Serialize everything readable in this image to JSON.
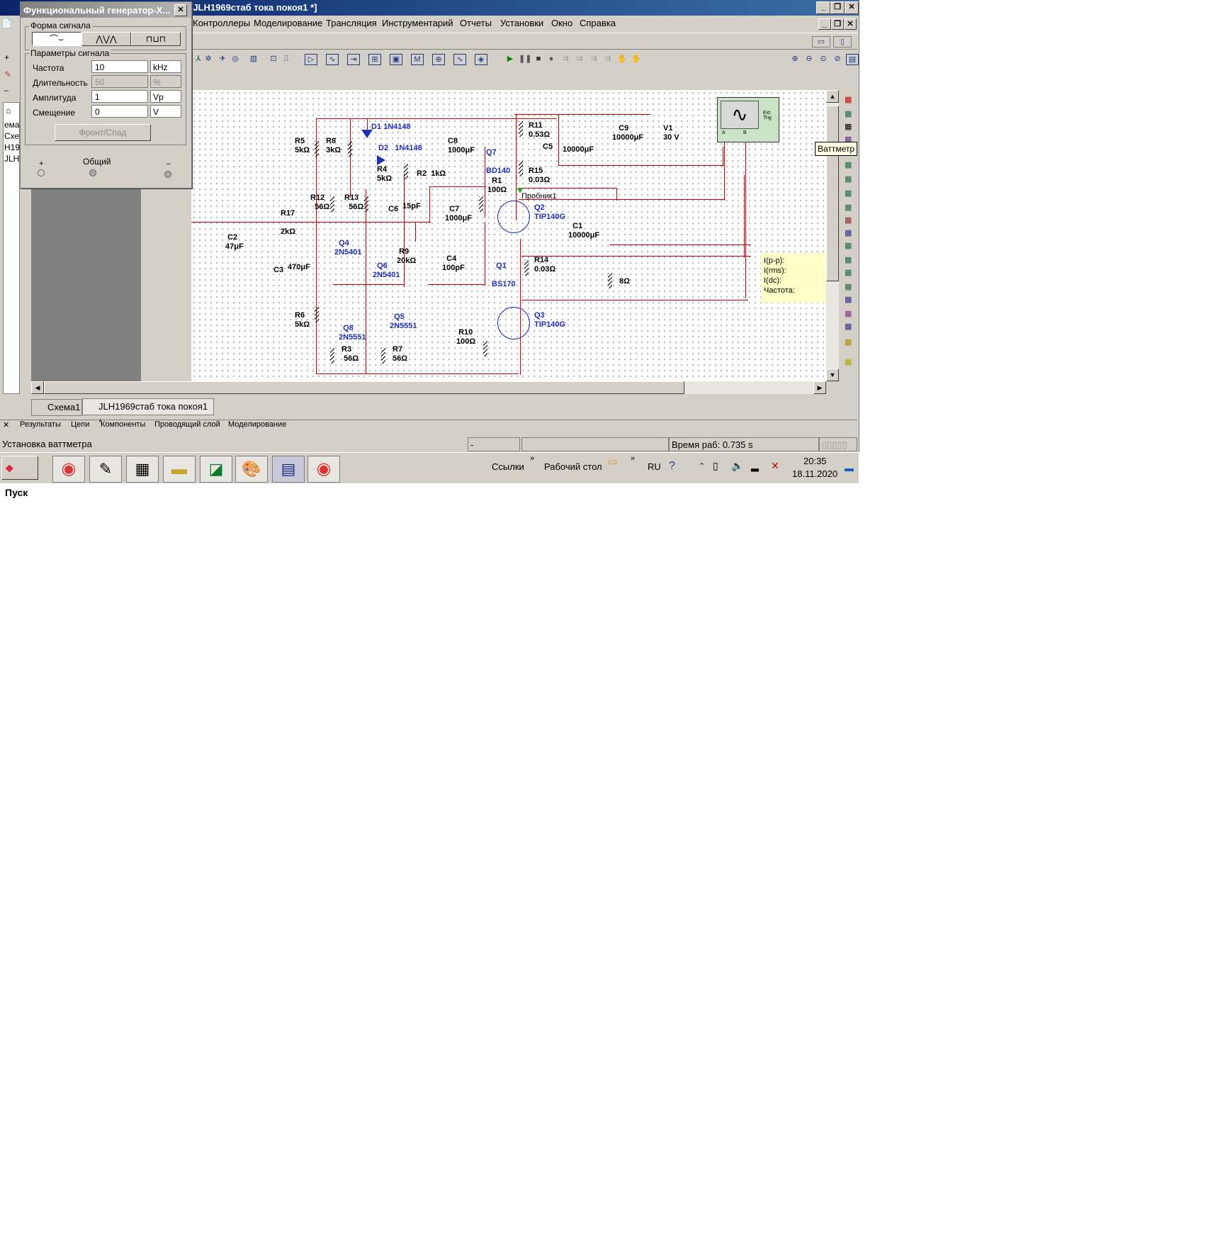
{
  "app": {
    "title": "[JLH1969стаб тока покоя1 *]"
  },
  "menu": {
    "items": [
      "Контроллеры",
      "Моделирование",
      "Трансляция",
      "Инструментарий",
      "Отчеты",
      "Установки",
      "Окно",
      "Справка"
    ]
  },
  "fgen": {
    "title": "Функциональный генератор-X...",
    "waveform_group": "Форма сигнала",
    "params_group": "Параметры сигнала",
    "params": [
      {
        "label": "Частота",
        "value": "10",
        "unit": "kHz"
      },
      {
        "label": "Длительность",
        "value": "50",
        "unit": "%"
      },
      {
        "label": "Амплитуда",
        "value": "1",
        "unit": "Vp"
      },
      {
        "label": "Смещение",
        "value": "0",
        "unit": "V"
      }
    ],
    "rise_fall_button": "Фронт/Спад",
    "plus": "+",
    "common": "Общий",
    "minus": "–"
  },
  "left_panel": {
    "lines": [
      "ема",
      "Схе",
      "Н19",
      "JLH"
    ]
  },
  "schematic": {
    "components": [
      {
        "ref": "D1",
        "val": "1N4148"
      },
      {
        "ref": "D2",
        "val": "1N4148"
      },
      {
        "ref": "R5",
        "val": "5kΩ"
      },
      {
        "ref": "R8",
        "val": "3kΩ"
      },
      {
        "ref": "R4",
        "val": "5kΩ"
      },
      {
        "ref": "R2",
        "val": "1kΩ"
      },
      {
        "ref": "C8",
        "val": "1000μF"
      },
      {
        "ref": "Q7",
        "val": "BD140"
      },
      {
        "ref": "R11",
        "val": "0.53Ω"
      },
      {
        "ref": "C5",
        "val": "10000μF"
      },
      {
        "ref": "C9",
        "val": "10000μF"
      },
      {
        "ref": "V1",
        "val": "30 V"
      },
      {
        "ref": "R15",
        "val": "0.03Ω"
      },
      {
        "ref": "R12",
        "val": "56Ω"
      },
      {
        "ref": "R13",
        "val": "56Ω"
      },
      {
        "ref": "R1",
        "val": "100Ω"
      },
      {
        "ref": "C6",
        "val": "15pF"
      },
      {
        "ref": "R17",
        "val": "2kΩ"
      },
      {
        "ref": "C2",
        "val": "47μF"
      },
      {
        "ref": "C7",
        "val": "1000μF"
      },
      {
        "ref": "Q2",
        "val": "TIP140G"
      },
      {
        "ref": "C1",
        "val": "10000μF"
      },
      {
        "ref": "Q4",
        "val": "2N5401"
      },
      {
        "ref": "R9",
        "val": "20kΩ"
      },
      {
        "ref": "C3",
        "val": "470μF"
      },
      {
        "ref": "Q6",
        "val": "2N5401"
      },
      {
        "ref": "C4",
        "val": "100pF"
      },
      {
        "ref": "Q1",
        "val": "BS170"
      },
      {
        "ref": "R14",
        "val": "0.03Ω"
      },
      {
        "ref": "",
        "val": "8Ω"
      },
      {
        "ref": "R6",
        "val": "5kΩ"
      },
      {
        "ref": "Q8",
        "val": "2N5551"
      },
      {
        "ref": "Q5",
        "val": "2N5551"
      },
      {
        "ref": "R10",
        "val": "100Ω"
      },
      {
        "ref": "Q3",
        "val": "TIP140G"
      },
      {
        "ref": "R3",
        "val": "56Ω"
      },
      {
        "ref": "R7",
        "val": "56Ω"
      }
    ],
    "probe": "Пробник1",
    "scope_trig": "Ext Trig",
    "scope_a": "A",
    "scope_b": "B",
    "probe_readout": [
      "I(p-p):",
      "I(rms):",
      "I(dc):",
      "Частота:"
    ],
    "tooltip": "Ваттметр"
  },
  "tabs": [
    "Схема1",
    "JLH1969стаб тока покоя1 *"
  ],
  "bottom_tabs": [
    "Результаты",
    "Цепи",
    "Компоненты",
    "Проводящий слой",
    "Моделирование"
  ],
  "status": {
    "left": "Установка ваттметра",
    "mid": "-",
    "time": "Время раб: 0.735 s"
  },
  "taskbar": {
    "start": "Пуск",
    "links": "Ссылки",
    "desktop": "Рабочий стол",
    "lang": "RU",
    "clock_time": "20:35",
    "clock_date": "18.11.2020"
  },
  "colors": {
    "wire": "#cc0000",
    "transistor_label": "#1f2fb8",
    "title_active": "#0a246a"
  }
}
